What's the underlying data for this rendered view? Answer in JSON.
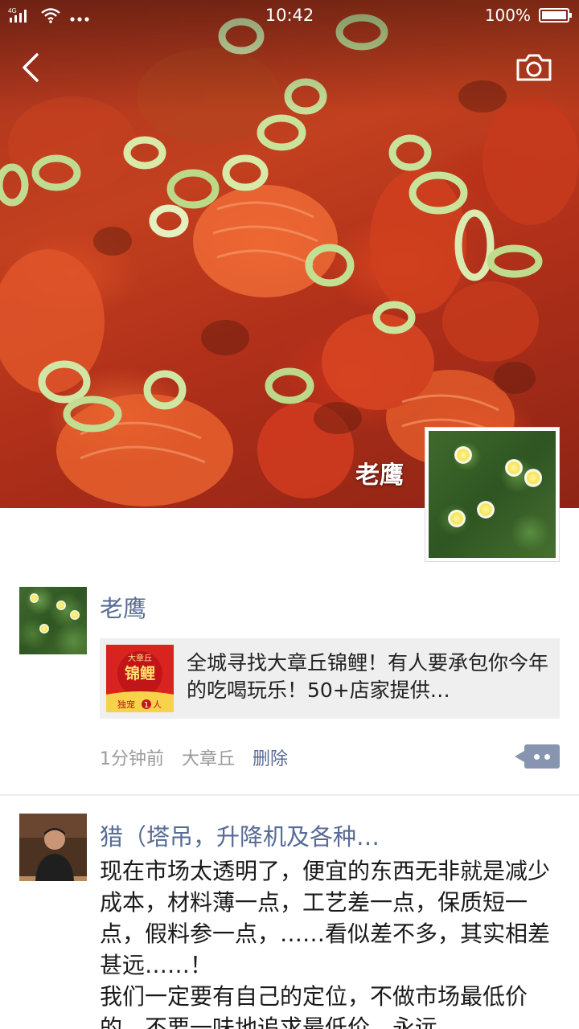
{
  "status_bar": {
    "network": "4G",
    "time": "10:42",
    "battery": "100%"
  },
  "nav": {
    "back_icon": "chevron-left-icon",
    "camera_icon": "camera-icon"
  },
  "profile": {
    "name": "老鹰"
  },
  "posts": [
    {
      "author": "老鹰",
      "share": {
        "thumb_text_top": "大章丘",
        "thumb_text_main": "锦鲤",
        "thumb_text_bottom_a": "独宠",
        "thumb_text_bottom_num": "1",
        "thumb_text_bottom_b": "人",
        "title": "全城寻找大章丘锦鲤！有人要承包你今年的吃喝玩乐！50+店家提供…"
      },
      "time": "1分钟前",
      "location": "大章丘",
      "delete_label": "删除"
    },
    {
      "author": "猎（塔吊，升降机及各种…",
      "paragraphs": [
        "现在市场太透明了，便宜的东西无非就是减少成本，材料薄一点，工艺差一点，保质短一点，假料参一点，……看似差不多，其实相差甚远……！",
        "我们一定要有自己的定位，不做市场最低价的，不要一味地追求最低价，永远"
      ]
    }
  ],
  "colors": {
    "link": "#576b95",
    "meta": "#9a9a9a",
    "card_bg": "#efefef"
  }
}
